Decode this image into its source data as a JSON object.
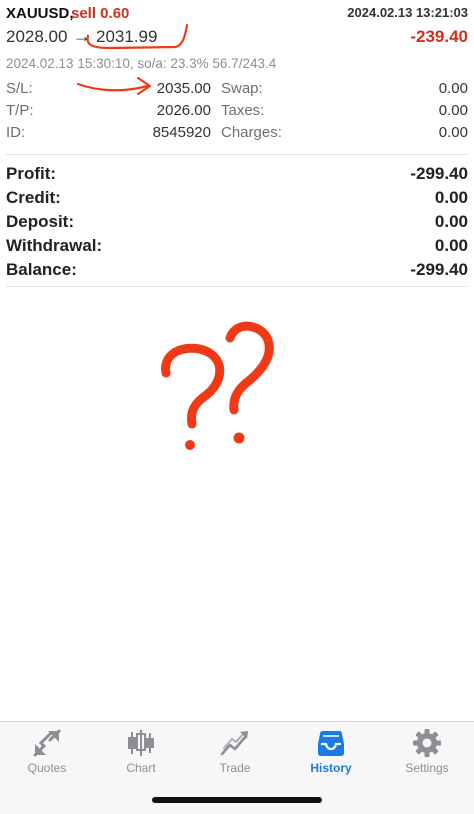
{
  "header": {
    "symbol": "XAUUSD,",
    "trade_type": "sell 0.60",
    "close_time": "2024.02.13 13:21:03",
    "open_price": "2028.00",
    "arrow": "→",
    "close_price": "2031.99",
    "profit": "-239.40"
  },
  "meta": {
    "open_time": "2024.02.13 15:30:10, so/a: 23.3% 56.7/243.4"
  },
  "details": {
    "sl_label": "S/L:",
    "sl_value": "2035.00",
    "tp_label": "T/P:",
    "tp_value": "2026.00",
    "id_label": "ID:",
    "id_value": "8545920",
    "swap_label": "Swap:",
    "swap_value": "0.00",
    "taxes_label": "Taxes:",
    "taxes_value": "0.00",
    "charges_label": "Charges:",
    "charges_value": "0.00"
  },
  "summary": [
    {
      "label": "Profit:",
      "value": "-299.40"
    },
    {
      "label": "Credit:",
      "value": "0.00"
    },
    {
      "label": "Deposit:",
      "value": "0.00"
    },
    {
      "label": "Withdrawal:",
      "value": "0.00"
    },
    {
      "label": "Balance:",
      "value": "-299.40"
    }
  ],
  "annotation": {
    "scribble": "??",
    "color": "#f03a17"
  },
  "tabs": [
    {
      "label": "Quotes",
      "icon": "quotes-icon"
    },
    {
      "label": "Chart",
      "icon": "chart-icon"
    },
    {
      "label": "Trade",
      "icon": "trade-icon"
    },
    {
      "label": "History",
      "icon": "history-icon",
      "active": true
    },
    {
      "label": "Settings",
      "icon": "settings-icon"
    }
  ],
  "colors": {
    "accent": "#1a7ae8",
    "loss": "#d0311f",
    "ink": "#f03a17"
  }
}
